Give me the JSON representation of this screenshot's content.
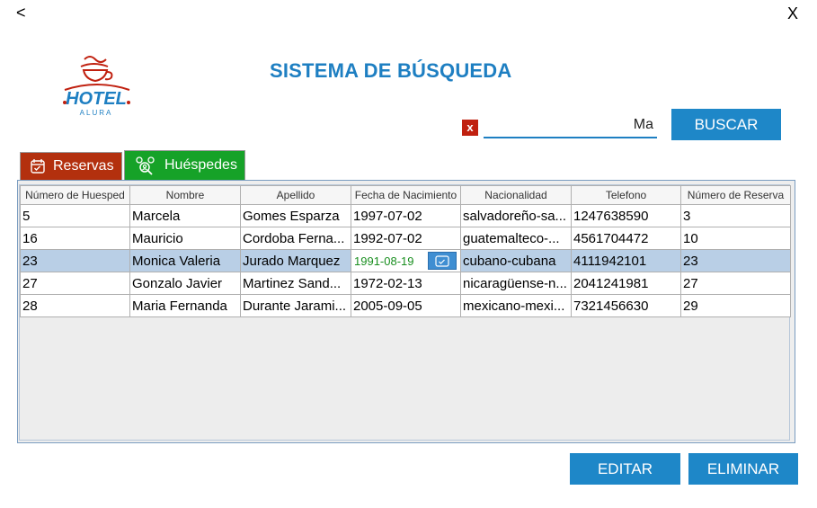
{
  "window": {
    "back_label": "<",
    "close_label": "X"
  },
  "logo": {
    "word": "HOTEL",
    "sub": "ALURA",
    "accent": "#c0200f"
  },
  "page_title": "SISTEMA DE BÚSQUEDA",
  "search": {
    "clear_label": "x",
    "value": "Ma",
    "button_label": "BUSCAR"
  },
  "tabs": [
    {
      "label": "Reservas",
      "color": "#b3300e",
      "icon": "calendar-check-icon"
    },
    {
      "label": "Huéspedes",
      "color": "#16a228",
      "icon": "users-search-icon"
    }
  ],
  "table": {
    "headers": [
      "Número de Huesped",
      "Nombre",
      "Apellido",
      "Fecha de Nacimiento",
      "Nacionalidad",
      "Telefono",
      "Número de Reserva"
    ],
    "rows": [
      [
        "5",
        "Marcela",
        "Gomes Esparza",
        "1997-07-02",
        "salvadoreño-sa...",
        "1247638590",
        "3"
      ],
      [
        "16",
        "Mauricio",
        "Cordoba Ferna...",
        "1992-07-02",
        "guatemalteco-...",
        "4561704472",
        "10"
      ],
      [
        "23",
        "Monica Valeria",
        "Jurado Marquez",
        "1991-08-19",
        "cubano-cubana",
        "4111942101",
        "23"
      ],
      [
        "27",
        "Gonzalo Javier",
        "Martinez Sand...",
        "1972-02-13",
        "nicaragüense-n...",
        "2041241981",
        "27"
      ],
      [
        "28",
        "Maria Fernanda",
        "Durante Jarami...",
        "2005-09-05",
        "mexicano-mexi...",
        "7321456630",
        "29"
      ]
    ],
    "selected_row": 2,
    "editing_date_value": "1991-08-19"
  },
  "actions": {
    "edit_label": "EDITAR",
    "delete_label": "ELIMINAR"
  },
  "colors": {
    "accent": "#1e87c8",
    "title": "#1e7fc2",
    "selection": "#b9cfe6"
  }
}
